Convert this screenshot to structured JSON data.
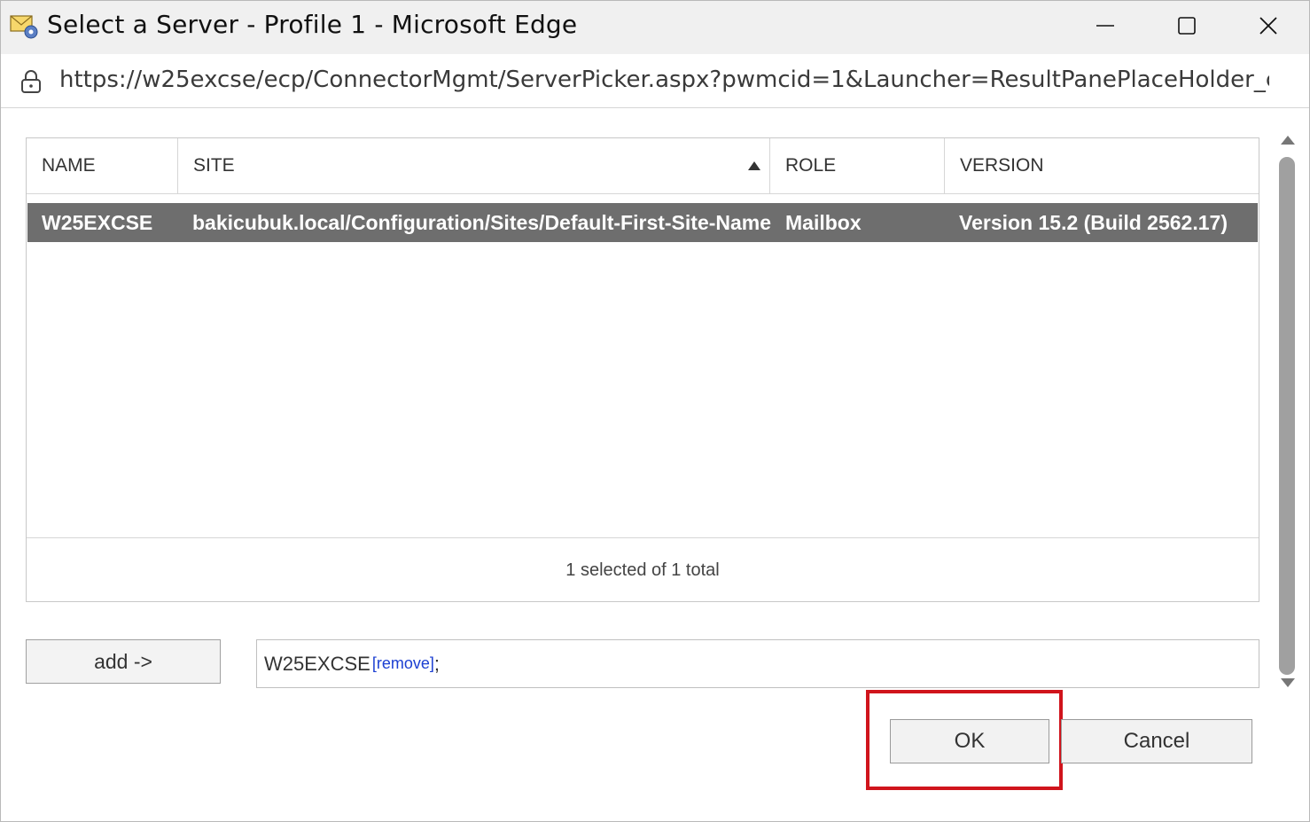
{
  "window": {
    "title": "Select a Server - Profile 1 - Microsoft Edge",
    "url": "https://w25excse/ecp/ConnectorMgmt/ServerPicker.aspx?pwmcid=1&Launcher=ResultPanePlaceHolder_ctl0..."
  },
  "grid": {
    "columns": [
      "NAME",
      "SITE",
      "ROLE",
      "VERSION"
    ],
    "sorted_column": "SITE",
    "rows": [
      {
        "name": "W25EXCSE",
        "site": "bakicubuk.local/Configuration/Sites/Default-First-Site-Name",
        "role": "Mailbox",
        "version": "Version 15.2 (Build 2562.17)",
        "selected": true
      }
    ],
    "footer": "1 selected of 1 total"
  },
  "picker": {
    "add_label": "add ->",
    "selected_value": "W25EXCSE",
    "remove_label": "[remove]",
    "separator": ";"
  },
  "buttons": {
    "ok_label": "OK",
    "cancel_label": "Cancel"
  },
  "colors": {
    "selected_row": "#6e6e6e",
    "highlight": "#d0141c",
    "link": "#1b3fd2"
  }
}
